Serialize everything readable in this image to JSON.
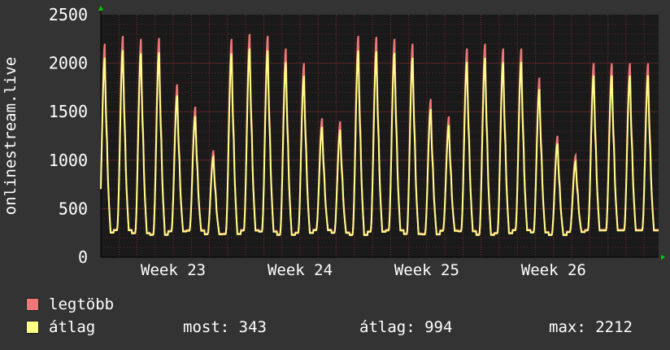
{
  "chart_data": {
    "type": "line",
    "ylabel": "onlinestream.live",
    "ylim": [
      0,
      2500
    ],
    "yticks": [
      0,
      500,
      1000,
      1500,
      2000,
      2500
    ],
    "xticks": [
      {
        "label": "Week 23",
        "day": 4
      },
      {
        "label": "Week 24",
        "day": 11
      },
      {
        "label": "Week 25",
        "day": 18
      },
      {
        "label": "Week 26",
        "day": 25
      }
    ],
    "grid": true,
    "x_unit": "day",
    "x_range": [
      0,
      30.8
    ],
    "colors": {
      "max": "#ee7777",
      "avg": "#ffff88",
      "plot_bg": "#1a1a1a",
      "grid": "#aa3333",
      "axis_arrow": "#00cc00"
    },
    "daily_peaks": [
      2200,
      2280,
      2250,
      2260,
      1780,
      1550,
      1100,
      2250,
      2300,
      2280,
      2150,
      2000,
      1430,
      1400,
      2280,
      2270,
      2250,
      2200,
      1630,
      1450,
      2150,
      2200,
      2150,
      2150,
      1850,
      1250,
      1050,
      2000
    ],
    "series": [
      {
        "name": "legtöbb",
        "color": "#ee7777"
      },
      {
        "name": "átlag",
        "color": "#ffff88"
      }
    ]
  },
  "legend": {
    "max_label": "legtöbb",
    "avg_label": "átlag",
    "now": "most: 343",
    "average": "átlag: 994",
    "maximum": "max: 2212"
  }
}
